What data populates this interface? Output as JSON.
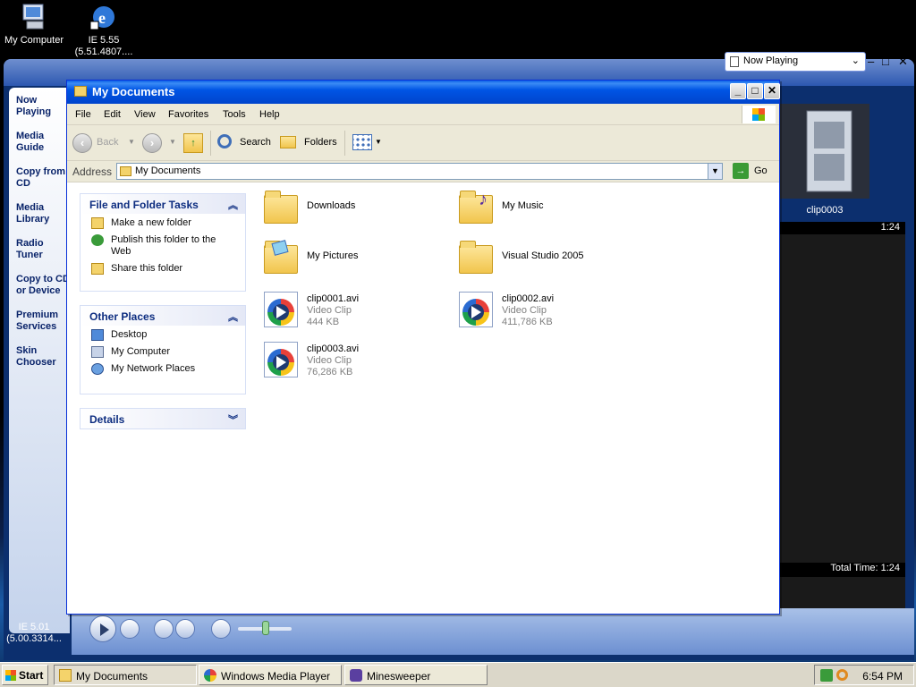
{
  "desktop": {
    "icons": [
      {
        "label": "My Computer"
      },
      {
        "label_line1": "IE 5.55",
        "label_line2": "(5.51.4807...."
      },
      {
        "label_line1": "IE 5.01",
        "label_line2": "(5.00.3314..."
      }
    ]
  },
  "wmp": {
    "sidebar": [
      "Now Playing",
      "Media Guide",
      "Copy from CD",
      "Media Library",
      "Radio Tuner",
      "Copy to CD or Device",
      "Premium Services",
      "Skin Chooser"
    ],
    "now_playing_dropdown": "Now Playing",
    "clip_label": "clip0003",
    "duration": "1:24",
    "total_time": "Total Time: 1:24"
  },
  "explorer": {
    "title": "My Documents",
    "menu": [
      "File",
      "Edit",
      "View",
      "Favorites",
      "Tools",
      "Help"
    ],
    "toolbar": {
      "back": "Back",
      "search": "Search",
      "folders": "Folders"
    },
    "address": {
      "label": "Address",
      "value": "My Documents",
      "go": "Go"
    },
    "panels": {
      "file_tasks": {
        "title": "File and Folder Tasks",
        "items": [
          "Make a new folder",
          "Publish this folder to the Web",
          "Share this folder"
        ]
      },
      "other_places": {
        "title": "Other Places",
        "items": [
          "Desktop",
          "My Computer",
          "My Network Places"
        ]
      },
      "details": {
        "title": "Details"
      }
    },
    "files": [
      {
        "name": "Downloads",
        "kind": "folder"
      },
      {
        "name": "My Music",
        "kind": "music-folder"
      },
      {
        "name": "My Pictures",
        "kind": "pictures-folder"
      },
      {
        "name": "Visual Studio 2005",
        "kind": "folder"
      },
      {
        "name": "clip0001.avi",
        "type": "Video Clip",
        "size": "444 KB"
      },
      {
        "name": "clip0002.avi",
        "type": "Video Clip",
        "size": "411,786 KB"
      },
      {
        "name": "clip0003.avi",
        "type": "Video Clip",
        "size": "76,286 KB"
      }
    ]
  },
  "taskbar": {
    "start": "Start",
    "tasks": [
      "My Documents",
      "Windows Media Player",
      "Minesweeper"
    ],
    "clock": "6:54 PM"
  }
}
